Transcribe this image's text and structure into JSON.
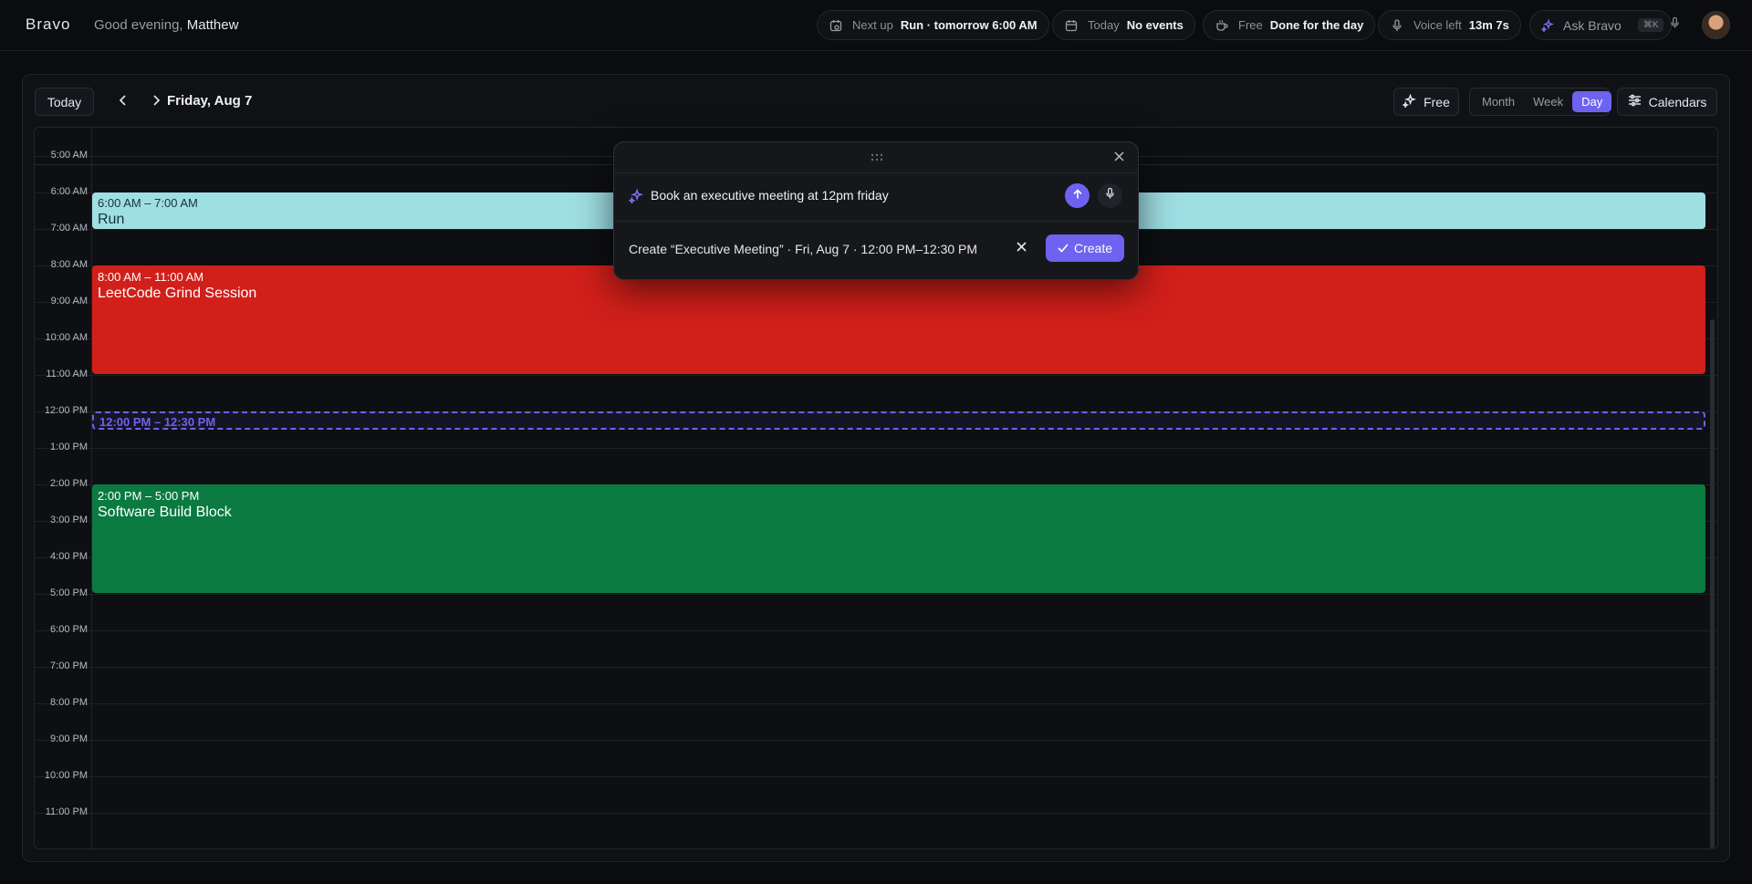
{
  "header": {
    "logo": "Bravo",
    "greeting_prefix": "Good evening,",
    "user_name": "Matthew",
    "next_up": {
      "label": "Next up",
      "value": "Run · tomorrow 6:00 AM"
    },
    "today": {
      "label": "Today",
      "value": "No events"
    },
    "free": {
      "label": "Free",
      "value": "Done for the day"
    },
    "voice": {
      "label": "Voice left",
      "value": "13m 7s"
    },
    "ask": {
      "label": "Ask Bravo",
      "shortcut": "⌘K"
    }
  },
  "toolbar": {
    "today_label": "Today",
    "date_title": "Friday, Aug 7",
    "free_label": "Free",
    "views": {
      "month": "Month",
      "week": "Week",
      "day": "Day"
    },
    "active_view": "Day",
    "calendars_label": "Calendars"
  },
  "hours": [
    "5:00 AM",
    "6:00 AM",
    "7:00 AM",
    "8:00 AM",
    "9:00 AM",
    "10:00 AM",
    "11:00 AM",
    "12:00 PM",
    "1:00 PM",
    "2:00 PM",
    "3:00 PM",
    "4:00 PM",
    "5:00 PM",
    "6:00 PM",
    "7:00 PM",
    "8:00 PM",
    "9:00 PM",
    "10:00 PM",
    "11:00 PM"
  ],
  "events": [
    {
      "time": "6:00 AM – 7:00 AM",
      "title": "Run",
      "color": "#9edfe4"
    },
    {
      "time": "8:00 AM – 11:00 AM",
      "title": "LeetCode Grind Session",
      "color": "#d11f1a"
    },
    {
      "time": "2:00 PM – 5:00 PM",
      "title": "Software Build Block",
      "color": "#0a7a41"
    }
  ],
  "pending_event": {
    "time": "12:00 PM – 12:30 PM"
  },
  "ask_dialog": {
    "query": "Book an executive meeting at 12pm friday",
    "suggestion": "Create “Executive Meeting” · Fri, Aug 7 · 12:00 PM–12:30 PM",
    "create_label": "Create"
  },
  "colors": {
    "accent": "#6e62f0",
    "background": "#0b0c0f"
  }
}
